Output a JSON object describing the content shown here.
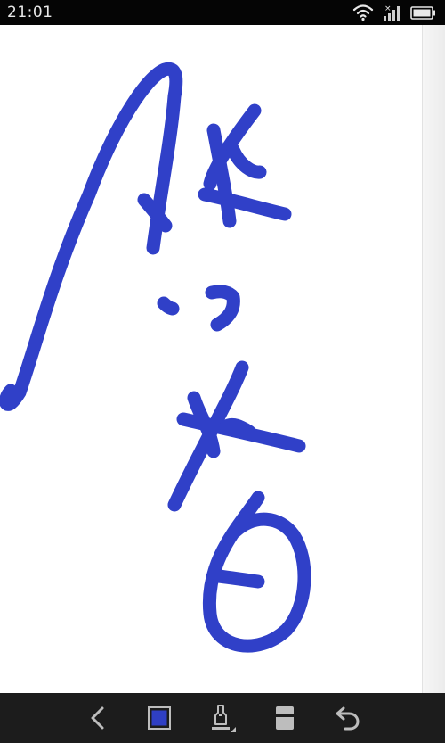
{
  "status_bar": {
    "time": "21:01",
    "icons": [
      "wifi-icon",
      "signal-no-sim-icon",
      "battery-icon"
    ]
  },
  "canvas": {
    "stroke_color": "#3040c8",
    "background": "#ffffff"
  },
  "toolbar": {
    "tools": [
      "back-icon",
      "color-swatch-icon",
      "pen-icon",
      "eraser-icon",
      "undo-icon"
    ],
    "selected_color": "#2f3fc4",
    "icon_color": "#bdbdbd"
  }
}
